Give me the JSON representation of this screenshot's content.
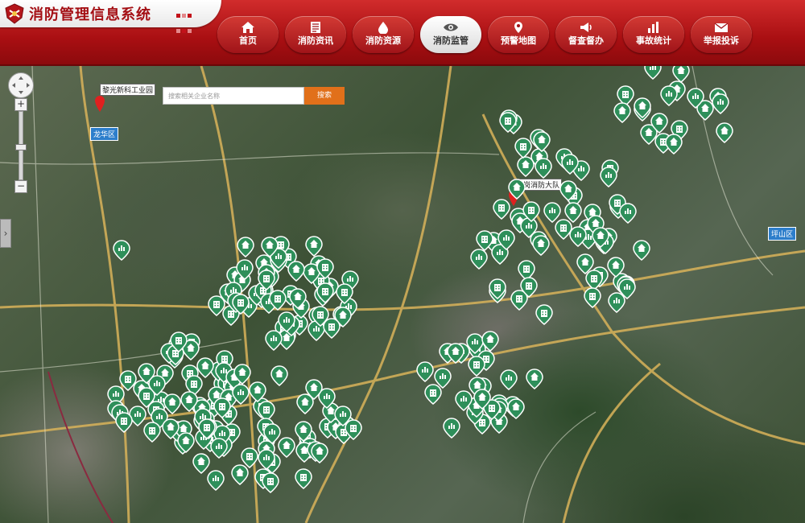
{
  "header": {
    "title": "消防管理信息系统",
    "nav": [
      {
        "label": "首页",
        "icon": "home-icon"
      },
      {
        "label": "消防资讯",
        "icon": "news-icon"
      },
      {
        "label": "消防资源",
        "icon": "drop-icon"
      },
      {
        "label": "消防监管",
        "icon": "eye-icon",
        "active": true
      },
      {
        "label": "预警地图",
        "icon": "map-pin-icon"
      },
      {
        "label": "督查督办",
        "icon": "megaphone-icon"
      },
      {
        "label": "事故统计",
        "icon": "bar-chart-icon"
      },
      {
        "label": "举报投诉",
        "icon": "envelope-icon"
      }
    ]
  },
  "map": {
    "search_placeholder": "搜索相关企业名称",
    "search_button": "搜索",
    "places": {
      "industrial_park": "黎光新科工业园",
      "fire_brigade": "龙岗消防大队",
      "longhua": "龙华区",
      "pingshan": "坪山区"
    },
    "colors": {
      "accent": "#b81a1f",
      "marker": "#2e8f5a",
      "pin": "#e0201f"
    }
  }
}
